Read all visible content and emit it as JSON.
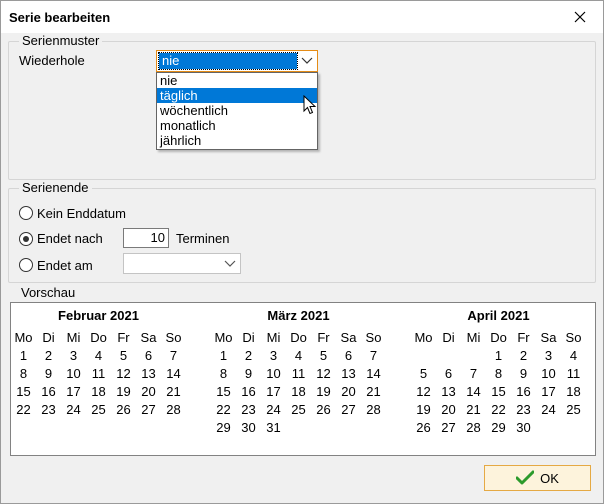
{
  "window": {
    "title": "Serie bearbeiten"
  },
  "pattern": {
    "legend": "Serienmuster",
    "repeat_label": "Wiederhole",
    "repeat_value": "nie",
    "options": [
      "nie",
      "täglich",
      "wöchentlich",
      "monatlich",
      "jährlich"
    ],
    "highlighted_option": "täglich"
  },
  "end": {
    "legend": "Serienende",
    "no_end_label": "Kein Enddatum",
    "ends_after_label": "Endet nach",
    "ends_after_count": "10",
    "occurrences_label": "Terminen",
    "ends_on_label": "Endet am",
    "ends_on_value": "",
    "selected": "Endet nach"
  },
  "preview": {
    "legend": "Vorschau",
    "weekdays": [
      "Mo",
      "Di",
      "Mi",
      "Do",
      "Fr",
      "Sa",
      "So"
    ],
    "months": [
      {
        "title": "Februar 2021",
        "leading_blanks": 0,
        "days": 28
      },
      {
        "title": "März 2021",
        "leading_blanks": 0,
        "days": 31
      },
      {
        "title": "April 2021",
        "leading_blanks": 3,
        "days": 30
      }
    ]
  },
  "buttons": {
    "ok_label": "OK"
  },
  "colors": {
    "accent": "#0078d7",
    "focus_border": "#e58c16",
    "ok_background": "#fdf3dc",
    "ok_check": "#2c9a2c"
  },
  "icons": [
    "close-icon",
    "chevron-down-icon",
    "check-icon",
    "cursor-icon"
  ]
}
